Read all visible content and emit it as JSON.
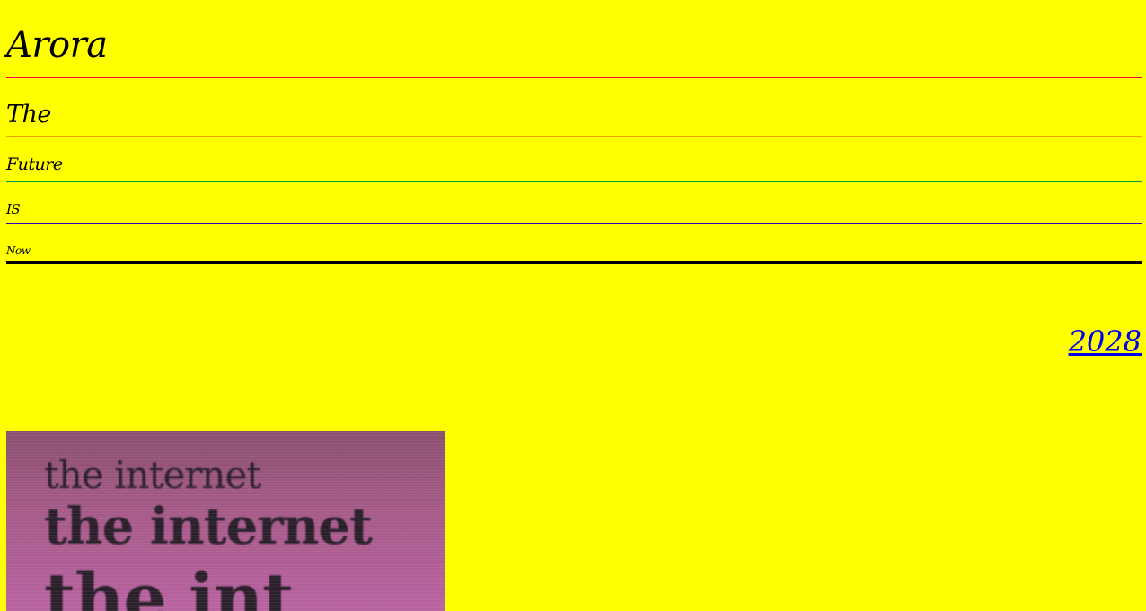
{
  "headings": {
    "title": "Arora",
    "the": "The",
    "future": "Future",
    "is": "IS",
    "now": "Now"
  },
  "link": {
    "year": "2028"
  },
  "poster": {
    "lines": [
      "the internet",
      "the internet",
      "the int"
    ]
  },
  "colors": {
    "background": "#ffff00",
    "link": "#0000ee",
    "poster": "#a55a88"
  }
}
